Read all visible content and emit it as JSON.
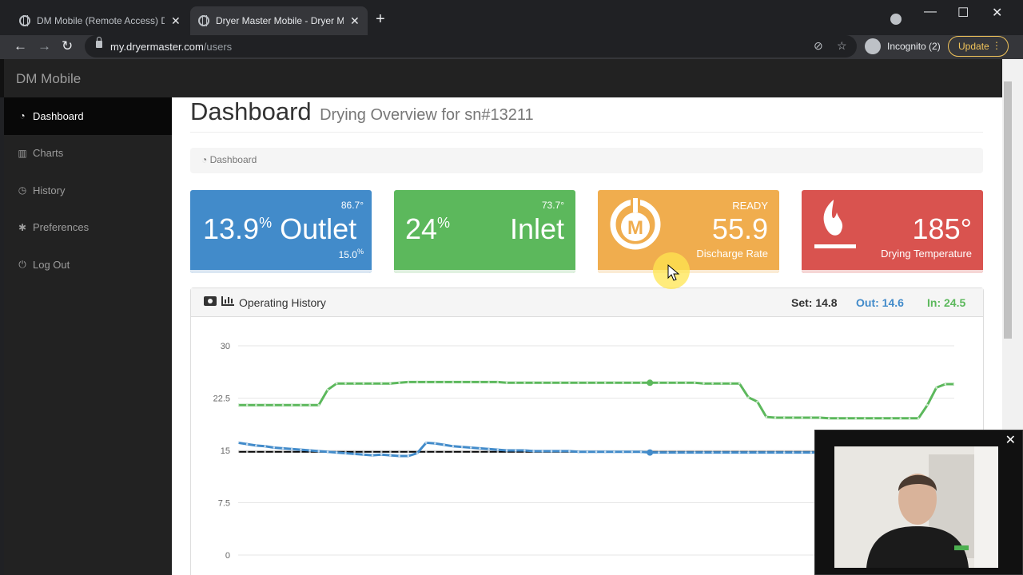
{
  "browser": {
    "tabs": [
      {
        "title": "DM Mobile (Remote Access) Dry",
        "close": "✕"
      },
      {
        "title": "Dryer Master Mobile - Dryer Mo",
        "close": "✕"
      }
    ],
    "new_tab": "+",
    "url_host": "my.dryermaster.com",
    "url_path": "/users",
    "profile": "Incognito (2)",
    "update_label": "Update",
    "window_controls": {
      "minimize": "—",
      "maximize": "☐",
      "close": "✕"
    }
  },
  "app": {
    "brand": "DM Mobile"
  },
  "sidebar": {
    "items": [
      {
        "label": "Dashboard",
        "icon": "dashboard-icon"
      },
      {
        "label": "Charts",
        "icon": "bar-chart-icon"
      },
      {
        "label": "History",
        "icon": "history-icon"
      },
      {
        "label": "Preferences",
        "icon": "gear-icon"
      },
      {
        "label": "Log Out",
        "icon": "power-icon"
      }
    ]
  },
  "page": {
    "title": "Dashboard",
    "subtitle": "Drying Overview for sn#13211",
    "breadcrumb": "Dashboard"
  },
  "cards": {
    "outlet": {
      "value": "13.9",
      "unit": "%",
      "label": "Outlet",
      "top": "86.7°",
      "bottom": "15.0",
      "bottom_unit": "%",
      "color": "#428bca"
    },
    "inlet": {
      "value": "24",
      "unit": "%",
      "label": "Inlet",
      "top": "73.7°",
      "color": "#5cb85c"
    },
    "discharge": {
      "status": "READY",
      "value": "55.9",
      "label": "Discharge Rate",
      "logo_letter": "M",
      "color": "#f0ad4e"
    },
    "drying": {
      "value": "185°",
      "label": "Drying Temperature",
      "color": "#d9534f"
    }
  },
  "history": {
    "title": "Operating History",
    "set_label": "Set: 14.8",
    "out_label": "Out: 14.6",
    "in_label": "In: 24.5"
  },
  "chart_data": {
    "type": "line",
    "ylim": [
      0,
      30
    ],
    "yticks": [
      "0",
      "7.5",
      "15",
      "22.5",
      "30"
    ],
    "x": [
      0,
      1,
      2,
      3,
      4,
      5,
      6,
      7,
      8,
      9,
      10,
      11,
      12,
      13,
      14,
      15,
      16,
      17,
      18,
      19,
      20,
      21,
      22,
      23,
      24,
      25,
      26,
      27,
      28,
      29,
      30,
      31,
      32,
      33,
      34,
      35,
      36,
      37,
      38,
      39,
      40,
      41,
      42,
      43,
      44,
      45,
      46,
      47,
      48,
      49,
      50,
      51,
      52,
      53,
      54,
      55,
      56,
      57,
      58,
      59,
      60,
      61,
      62,
      63,
      64,
      65,
      66,
      67,
      68,
      69,
      70,
      71,
      72,
      73,
      74,
      75,
      76,
      77,
      78,
      79,
      80
    ],
    "series": [
      {
        "name": "In",
        "color": "#5cb85c",
        "values": [
          21.5,
          21.5,
          21.5,
          21.5,
          21.5,
          21.5,
          21.5,
          21.5,
          21.5,
          21.5,
          23.7,
          24.6,
          24.6,
          24.6,
          24.6,
          24.6,
          24.6,
          24.6,
          24.7,
          24.8,
          24.8,
          24.8,
          24.8,
          24.8,
          24.8,
          24.8,
          24.8,
          24.8,
          24.8,
          24.8,
          24.7,
          24.7,
          24.7,
          24.7,
          24.7,
          24.7,
          24.7,
          24.7,
          24.7,
          24.7,
          24.7,
          24.7,
          24.7,
          24.7,
          24.7,
          24.7,
          24.7,
          24.7,
          24.7,
          24.7,
          24.7,
          24.7,
          24.6,
          24.6,
          24.6,
          24.6,
          24.6,
          22.6,
          22.0,
          19.8,
          19.7,
          19.7,
          19.7,
          19.7,
          19.7,
          19.7,
          19.6,
          19.6,
          19.6,
          19.6,
          19.6,
          19.6,
          19.6,
          19.6,
          19.6,
          19.6,
          19.6,
          21.5,
          24.0,
          24.5,
          24.5
        ]
      },
      {
        "name": "Out",
        "color": "#428bca",
        "values": [
          16.1,
          15.9,
          15.7,
          15.6,
          15.4,
          15.3,
          15.2,
          15.1,
          15.0,
          14.9,
          14.8,
          14.7,
          14.6,
          14.5,
          14.4,
          14.3,
          14.4,
          14.3,
          14.2,
          14.2,
          14.6,
          16.1,
          16.0,
          15.8,
          15.6,
          15.5,
          15.4,
          15.3,
          15.2,
          15.1,
          15.0,
          15.0,
          15.0,
          14.9,
          14.9,
          14.9,
          14.9,
          14.9,
          14.8,
          14.8,
          14.8,
          14.8,
          14.8,
          14.8,
          14.8,
          14.8,
          14.7,
          14.7,
          14.7,
          14.7,
          14.7,
          14.7,
          14.7,
          14.7,
          14.7,
          14.7,
          14.7,
          14.7,
          14.7,
          14.7,
          14.7,
          14.7,
          14.7,
          14.7,
          14.7,
          14.7,
          14.7,
          14.7,
          14.7,
          14.7,
          14.7,
          14.7,
          14.7,
          14.7,
          14.7,
          14.7,
          14.7,
          14.7,
          14.7,
          14.7,
          14.7
        ]
      },
      {
        "name": "Set",
        "color": "#000000",
        "values": [
          14.8,
          14.8,
          14.8,
          14.8,
          14.8,
          14.8,
          14.8,
          14.8,
          14.8,
          14.8,
          14.8,
          14.8,
          14.8,
          14.8,
          14.8,
          14.8,
          14.8,
          14.8,
          14.8,
          14.8,
          14.8,
          14.8,
          14.8,
          14.8,
          14.8,
          14.8,
          14.8,
          14.8,
          14.8,
          14.8,
          14.8,
          14.8,
          14.8,
          14.8,
          14.8,
          14.8,
          14.8,
          14.8,
          14.8,
          14.8,
          14.8,
          14.8,
          14.8,
          14.8,
          14.8,
          14.8,
          14.8,
          14.8,
          14.8,
          14.8,
          14.8,
          14.8,
          14.8,
          14.8,
          14.8,
          14.8,
          14.8,
          14.8,
          14.8,
          14.8,
          14.8,
          14.8,
          14.8,
          14.8,
          14.8,
          14.8,
          14.8,
          14.8,
          14.8,
          14.8,
          14.8,
          14.8,
          14.8,
          14.8,
          14.8,
          14.8,
          14.8,
          14.8,
          14.8,
          14.8,
          14.8
        ]
      }
    ],
    "grid": true,
    "highlight_index": 46
  },
  "video_overlay": {
    "close": "✕"
  }
}
